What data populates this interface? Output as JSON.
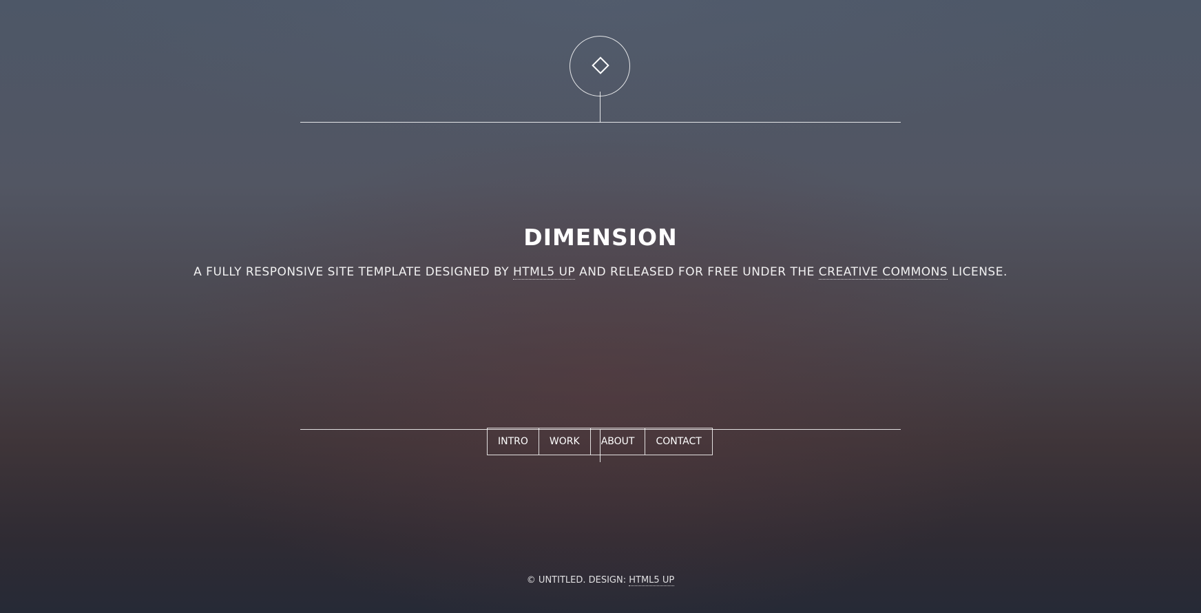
{
  "header": {
    "logo_icon": "diamond-icon",
    "title": "DIMENSION",
    "tagline_prefix": "A FULLY RESPONSIVE SITE TEMPLATE DESIGNED BY",
    "tagline_link1": "HTML5 UP",
    "tagline_middle": "AND RELEASED FOR FREE UNDER THE",
    "tagline_link2": "CREATIVE COMMONS",
    "tagline_suffix": "LICENSE."
  },
  "nav": {
    "items": [
      {
        "label": "INTRO"
      },
      {
        "label": "WORK"
      },
      {
        "label": "ABOUT"
      },
      {
        "label": "CONTACT"
      }
    ]
  },
  "footer": {
    "copyright": "© UNTITLED. DESIGN:",
    "link": "HTML5 UP"
  },
  "colors": {
    "text": "#ffffff",
    "background_top": "#4d5767",
    "background_bottom": "#262a36"
  }
}
